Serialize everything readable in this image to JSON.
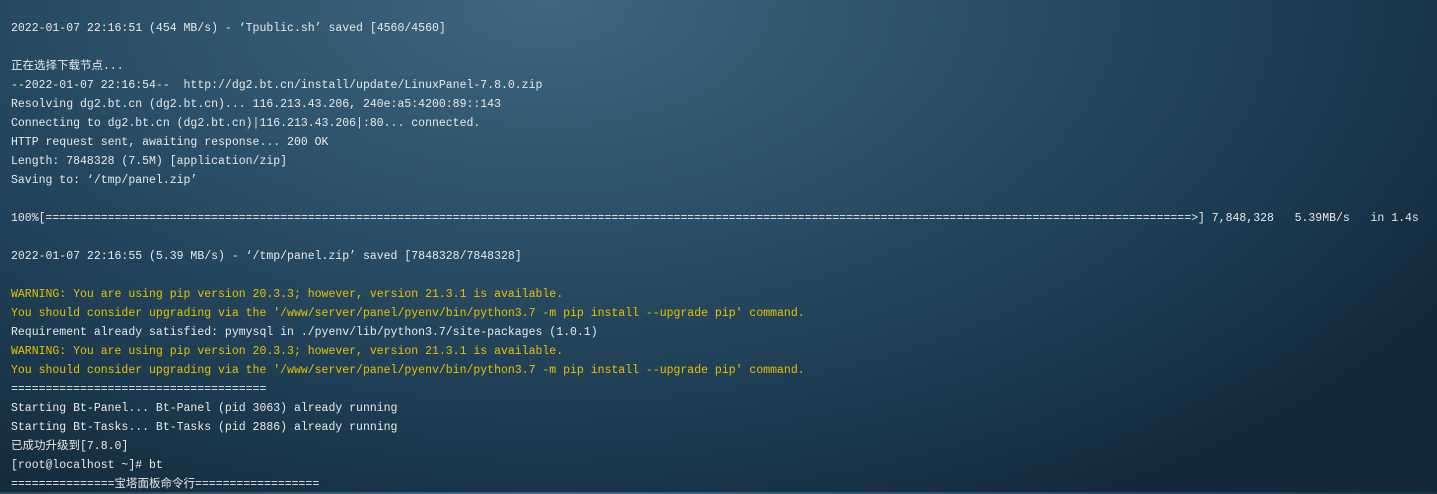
{
  "terminal": {
    "lines": [
      {
        "text": "2022-01-07 22:16:51 (454 MB/s) - ‘Tpublic.sh’ saved [4560/4560]",
        "type": "normal"
      },
      {
        "text": "",
        "type": "normal"
      },
      {
        "text": "正在选择下载节点...",
        "type": "normal"
      },
      {
        "text": "--2022-01-07 22:16:54--  http://dg2.bt.cn/install/update/LinuxPanel-7.8.0.zip",
        "type": "normal"
      },
      {
        "text": "Resolving dg2.bt.cn (dg2.bt.cn)... 116.213.43.206, 240e:a5:4200:89::143",
        "type": "normal"
      },
      {
        "text": "Connecting to dg2.bt.cn (dg2.bt.cn)|116.213.43.206|:80... connected.",
        "type": "normal"
      },
      {
        "text": "HTTP request sent, awaiting response... 200 OK",
        "type": "normal"
      },
      {
        "text": "Length: 7848328 (7.5M) [application/zip]",
        "type": "normal"
      },
      {
        "text": "Saving to: ‘/tmp/panel.zip’",
        "type": "normal"
      },
      {
        "text": "",
        "type": "normal"
      },
      {
        "text": "100%[======================================================================================================================================================================>] 7,848,328   5.39MB/s   in 1.4s",
        "type": "progress"
      },
      {
        "text": "",
        "type": "normal"
      },
      {
        "text": "2022-01-07 22:16:55 (5.39 MB/s) - ‘/tmp/panel.zip’ saved [7848328/7848328]",
        "type": "normal"
      },
      {
        "text": "",
        "type": "normal"
      },
      {
        "text": "WARNING: You are using pip version 20.3.3; however, version 21.3.1 is available.",
        "type": "warning"
      },
      {
        "text": "You should consider upgrading via the '/www/server/panel/pyenv/bin/python3.7 -m pip install --upgrade pip' command.",
        "type": "warning"
      },
      {
        "text": "Requirement already satisfied: pymysql in ./pyenv/lib/python3.7/site-packages (1.0.1)",
        "type": "normal"
      },
      {
        "text": "WARNING: You are using pip version 20.3.3; however, version 21.3.1 is available.",
        "type": "warning"
      },
      {
        "text": "You should consider upgrading via the '/www/server/panel/pyenv/bin/python3.7 -m pip install --upgrade pip' command.",
        "type": "warning"
      },
      {
        "text": "=====================================",
        "type": "normal"
      },
      {
        "text": "Starting Bt-Panel... Bt-Panel (pid 3063) already running",
        "type": "normal"
      },
      {
        "text": "Starting Bt-Tasks... Bt-Tasks (pid 2886) already running",
        "type": "normal"
      },
      {
        "text": "已成功升级到[7.8.0]",
        "type": "normal"
      },
      {
        "text": "[root@localhost ~]# bt",
        "type": "prompt"
      },
      {
        "text": "===============宝塔面板命令行==================",
        "type": "normal"
      }
    ],
    "colors": {
      "text": "#e8e8e8",
      "warning": "#e8c000"
    }
  }
}
